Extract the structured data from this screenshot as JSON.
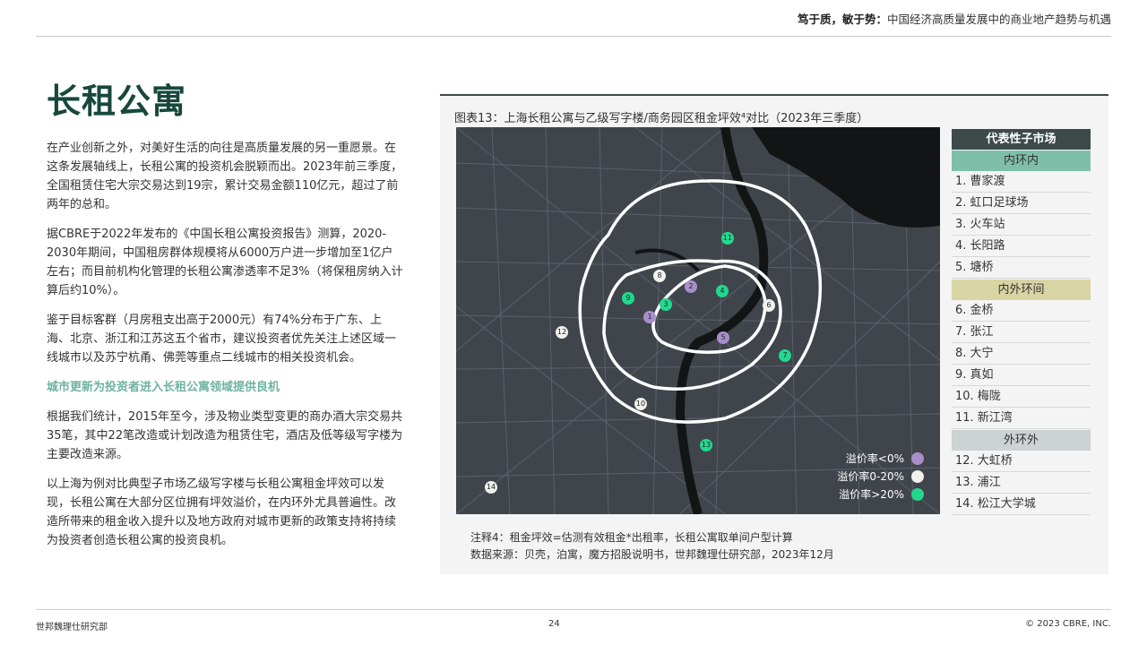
{
  "header": {
    "bold": "笃于质，敏于势：",
    "rest": "中国经济高质量发展中的商业地产趋势与机遇"
  },
  "title": "长租公寓",
  "paragraphs": [
    "在产业创新之外，对美好生活的向往是高质量发展的另一重愿景。在这条发展轴线上，长租公寓的投资机会脱颖而出。2023年前三季度，全国租赁住宅大宗交易达到19宗，累计交易金额110亿元，超过了前两年的总和。",
    "据CBRE于2022年发布的《中国长租公寓投资报告》测算，2020-2030年期间，中国租房群体规模将从6000万户进一步增加至1亿户左右；而目前机构化管理的长租公寓渗透率不足3%（将保租房纳入计算后约10%）。",
    "鉴于目标客群（月房租支出高于2000元）有74%分布于广东、上海、北京、浙江和江苏这五个省市，建议投资者优先关注上述区域一线城市以及苏宁杭甬、佛莞等重点二线城市的相关投资机会。"
  ],
  "subheading": "城市更新为投资者进入长租公寓领域提供良机",
  "paragraphs2": [
    "根据我们统计，2015年至今，涉及物业类型变更的商办酒大宗交易共35笔，其中22笔改造或计划改造为租赁住宅，酒店及低等级写字楼为主要改造来源。",
    "以上海为例对比典型子市场乙级写字楼与长租公寓租金坪效可以发现，长租公寓在大部分区位拥有坪效溢价，在内环外尤具普遍性。改造所带来的租金收入提升以及地方政府对城市更新的政策支持将持续为投资者创造长租公寓的投资良机。"
  ],
  "figure": {
    "title": "图表13：上海长租公寓与乙级写字楼/商务园区租金坪效⁴对比（2023年三季度）",
    "markers": [
      {
        "n": "1",
        "cat": "purple"
      },
      {
        "n": "2",
        "cat": "purple"
      },
      {
        "n": "3",
        "cat": "green"
      },
      {
        "n": "4",
        "cat": "green"
      },
      {
        "n": "5",
        "cat": "purple"
      },
      {
        "n": "6",
        "cat": "white"
      },
      {
        "n": "7",
        "cat": "green"
      },
      {
        "n": "8",
        "cat": "white"
      },
      {
        "n": "9",
        "cat": "green"
      },
      {
        "n": "10",
        "cat": "white"
      },
      {
        "n": "11",
        "cat": "green"
      },
      {
        "n": "12",
        "cat": "white"
      },
      {
        "n": "13",
        "cat": "green"
      },
      {
        "n": "14",
        "cat": "white"
      }
    ],
    "legend": [
      {
        "label": "溢价率<0%",
        "color": "#a88fcb"
      },
      {
        "label": "溢价率0-20%",
        "color": "#f0f0ec"
      },
      {
        "label": "溢价率>20%",
        "color": "#22d88e"
      }
    ],
    "side_header": "代表性子市场",
    "groups": [
      {
        "name": "内环内",
        "items": [
          "1. 曹家渡",
          "2. 虹口足球场",
          "3. 火车站",
          "4. 长阳路",
          "5. 塘桥"
        ]
      },
      {
        "name": "内外环间",
        "items": [
          "6. 金桥",
          "7. 张江",
          "8. 大宁",
          "9. 真如",
          "10. 梅陇",
          "11. 新江湾"
        ]
      },
      {
        "name": "外环外",
        "items": [
          "12. 大虹桥",
          "13. 浦江",
          "14. 松江大学城"
        ]
      }
    ],
    "note": "注释4：租金坪效=估测有效租金*出租率，长租公寓取单间户型计算",
    "source": "数据来源：贝壳，泊寓，魔方招股说明书，世邦魏理仕研究部，2023年12月"
  },
  "footer": {
    "left": "世邦魏理仕研究部",
    "page": "24",
    "right": "© 2023 CBRE, INC."
  }
}
